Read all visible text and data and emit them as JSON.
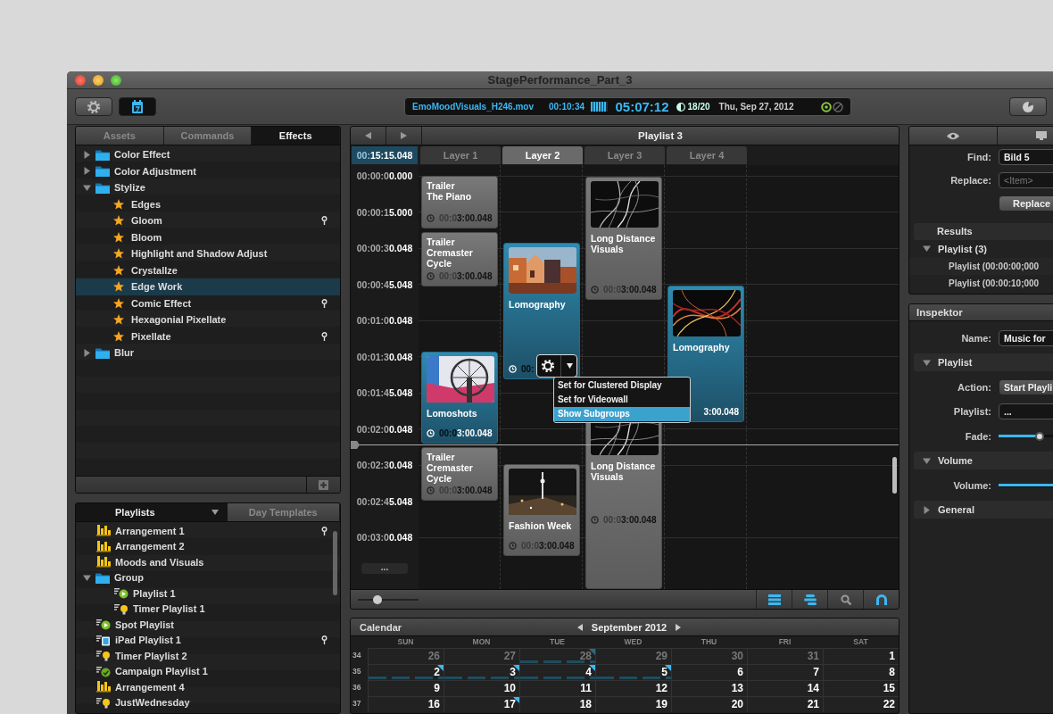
{
  "window": {
    "title": "StagePerformance_Part_3"
  },
  "toolbar": {
    "buttons": [
      {
        "kind": "settings",
        "selected": false
      },
      {
        "kind": "calendar",
        "selected": true
      },
      {
        "kind": "dial",
        "selected": false
      }
    ],
    "display": {
      "file": "EmoMoodVisuals_H246.mov",
      "elapsed": "00:10:34",
      "level": 0.85,
      "clock": "05:07:12",
      "count": "18/20",
      "date": "Thu, Sep 27, 2012"
    }
  },
  "effects_panel": {
    "tabs": [
      {
        "label": "Assets",
        "selected": false
      },
      {
        "label": "Commands",
        "selected": false
      },
      {
        "label": "Effects",
        "selected": true
      }
    ],
    "tree": [
      {
        "label": "Color Effect",
        "expanded": false,
        "selected": false,
        "pinned": false
      },
      {
        "label": "Color Adjustment",
        "expanded": false,
        "selected": false,
        "pinned": false
      },
      {
        "label": "Stylize",
        "expanded": true,
        "selected": false,
        "pinned": false,
        "children": [
          {
            "label": "Edges",
            "selected": false,
            "pinned": false
          },
          {
            "label": "Gloom",
            "selected": false,
            "pinned": true
          },
          {
            "label": "Bloom",
            "selected": false,
            "pinned": false
          },
          {
            "label": "Highlight and Shadow Adjust",
            "selected": false,
            "pinned": false
          },
          {
            "label": "Crystallze",
            "selected": false,
            "pinned": false
          },
          {
            "label": "Edge Work",
            "selected": true,
            "pinned": false
          },
          {
            "label": "Comic Effect",
            "selected": false,
            "pinned": true
          },
          {
            "label": "Hexagonial Pixellate",
            "selected": false,
            "pinned": false
          },
          {
            "label": "Pixellate",
            "selected": false,
            "pinned": true
          }
        ]
      },
      {
        "label": "Blur",
        "expanded": false,
        "selected": false,
        "pinned": false
      }
    ]
  },
  "playlists_panel": {
    "tabs": [
      {
        "label": "Playlists",
        "selected": true,
        "dropdown": true
      },
      {
        "label": "Day Templates",
        "selected": false,
        "dropdown": false
      }
    ],
    "items": [
      {
        "label": "Arrangement 1",
        "kind": "arrangement",
        "pinned": true
      },
      {
        "label": "Arrangement 2",
        "kind": "arrangement",
        "pinned": false
      },
      {
        "label": "Moods and Visuals",
        "kind": "arrangement",
        "pinned": false
      },
      {
        "label": "Group",
        "kind": "folder",
        "pinned": false,
        "expanded": true,
        "children": [
          {
            "label": "Playlist 1",
            "kind": "playlist",
            "pinned": false
          },
          {
            "label": "Timer Playlist 1",
            "kind": "timer",
            "pinned": false
          }
        ]
      },
      {
        "label": "Spot Playlist",
        "kind": "playlist",
        "pinned": false
      },
      {
        "label": "iPad Playlist 1",
        "kind": "tablet",
        "pinned": true
      },
      {
        "label": "Timer Playlist 2",
        "kind": "timer",
        "pinned": false
      },
      {
        "label": "Campaign Playlist 1",
        "kind": "campaign",
        "pinned": false
      },
      {
        "label": "Arrangement 4",
        "kind": "arrangement",
        "pinned": false
      },
      {
        "label": "JustWednesday",
        "kind": "timer",
        "pinned": false
      }
    ]
  },
  "timeline": {
    "title": "Playlist 3",
    "current_time": "00:**15:15.048**",
    "ruler": [
      "00:00:0**0.000**",
      "00:00:1**5.000**",
      "00:00:3**0.048**",
      "00:00:4**5.048**",
      "00:01:0**0.048**",
      "00:01:3**0.048**",
      "00:01:4**5.048**",
      "00:02:0**0.048**",
      "00:02:3**0.048**",
      "00:02:4**5.048**",
      "00:03:0**0.048**"
    ],
    "more_button": "...",
    "layers": [
      {
        "label": "Layer 1",
        "selected": false,
        "clips": [
          {
            "title_lines": [
              "Trailer",
              "The Piano"
            ],
            "duration": "00:0**3:00.048**",
            "selected": false,
            "thumbnail": false,
            "clock": true
          },
          {
            "title_lines": [
              "Trailer",
              "Cremaster",
              "Cycle"
            ],
            "duration": "00:0**3:00.048**",
            "selected": false,
            "thumbnail": false,
            "clock": true
          },
          {
            "title_lines": [
              "Lomoshots"
            ],
            "duration": "00:0**3:00.048**",
            "selected": true,
            "thumbnail": true,
            "clock": true
          },
          {
            "title_lines": [
              "Trailer",
              "Cremaster",
              "Cycle"
            ],
            "duration": "00:0**3:00.048**",
            "selected": false,
            "thumbnail": false,
            "clock": true
          }
        ]
      },
      {
        "label": "Layer 2",
        "selected": true,
        "clips": [
          {
            "title_lines": [
              "Lomography"
            ],
            "duration": "00:",
            "selected": true,
            "thumbnail": true,
            "clock": true
          },
          {
            "title_lines": [
              "Fashion Week"
            ],
            "duration": "00:0**3:00.048**",
            "selected": false,
            "thumbnail": true,
            "clock": true
          }
        ]
      },
      {
        "label": "Layer 3",
        "selected": false,
        "clips": [
          {
            "title_lines": [
              "Long Distance",
              "Visuals"
            ],
            "duration": "00:0**3:00.048**",
            "selected": false,
            "thumbnail": true,
            "clock": true
          },
          {
            "title_lines": [
              "Long Distance",
              "Visuals"
            ],
            "duration": "00:0**3:00.048**",
            "selected": false,
            "thumbnail": true,
            "clock": true
          }
        ]
      },
      {
        "label": "Layer 4",
        "selected": false,
        "clips": [
          {
            "title_lines": [
              "Lomography"
            ],
            "duration": "**3:00.048**",
            "selected": true,
            "thumbnail": true,
            "clock": false
          }
        ]
      }
    ],
    "gear_menu": {
      "items": [
        {
          "label": "Set for Clustered Display",
          "selected": false
        },
        {
          "label": "Set for Videowall",
          "selected": false
        },
        {
          "label": "Show Subgroups",
          "selected": true
        }
      ]
    },
    "zoom": {
      "level": 0.33
    },
    "tools": [
      {
        "kind": "list",
        "on": true
      },
      {
        "kind": "align",
        "on": true
      },
      {
        "kind": "search",
        "on": false
      },
      {
        "kind": "magnet",
        "on": true
      }
    ]
  },
  "calendar": {
    "title": "Calendar",
    "month": "September 2012",
    "weekdays": [
      "SUN",
      "MON",
      "TUE",
      "WED",
      "THU",
      "FRI",
      "SAT"
    ],
    "weeks": [
      {
        "number": "34",
        "days": [
          {
            "day": "26",
            "muted": true,
            "marked": false,
            "events": false
          },
          {
            "day": "27",
            "muted": true,
            "marked": false,
            "events": false
          },
          {
            "day": "28",
            "muted": true,
            "marked": true,
            "events": true
          },
          {
            "day": "29",
            "muted": true,
            "marked": false,
            "events": false
          },
          {
            "day": "30",
            "muted": true,
            "marked": false,
            "events": false
          },
          {
            "day": "31",
            "muted": true,
            "marked": false,
            "events": false
          },
          {
            "day": "1",
            "muted": false,
            "marked": false,
            "events": false
          }
        ]
      },
      {
        "number": "35",
        "days": [
          {
            "day": "2",
            "muted": false,
            "marked": true,
            "events": true
          },
          {
            "day": "3",
            "muted": false,
            "marked": true,
            "events": true
          },
          {
            "day": "4",
            "muted": false,
            "marked": true,
            "events": true
          },
          {
            "day": "5",
            "muted": false,
            "marked": true,
            "events": true
          },
          {
            "day": "6",
            "muted": false,
            "marked": false,
            "events": false
          },
          {
            "day": "7",
            "muted": false,
            "marked": false,
            "events": false
          },
          {
            "day": "8",
            "muted": false,
            "marked": false,
            "events": false
          }
        ]
      },
      {
        "number": "36",
        "days": [
          {
            "day": "9",
            "muted": false,
            "marked": false,
            "events": false
          },
          {
            "day": "10",
            "muted": false,
            "marked": false,
            "events": false
          },
          {
            "day": "11",
            "muted": false,
            "marked": false,
            "events": false
          },
          {
            "day": "12",
            "muted": false,
            "marked": false,
            "events": false
          },
          {
            "day": "13",
            "muted": false,
            "marked": false,
            "events": false
          },
          {
            "day": "14",
            "muted": false,
            "marked": false,
            "events": false
          },
          {
            "day": "15",
            "muted": false,
            "marked": false,
            "events": false
          }
        ]
      },
      {
        "number": "37",
        "days": [
          {
            "day": "16",
            "muted": false,
            "marked": false,
            "events": false
          },
          {
            "day": "17",
            "muted": false,
            "marked": true,
            "events": false
          },
          {
            "day": "18",
            "muted": false,
            "marked": false,
            "events": false
          },
          {
            "day": "19",
            "muted": false,
            "marked": false,
            "events": false
          },
          {
            "day": "20",
            "muted": false,
            "marked": false,
            "events": false
          },
          {
            "day": "21",
            "muted": false,
            "marked": false,
            "events": false
          },
          {
            "day": "22",
            "muted": false,
            "marked": false,
            "events": false
          }
        ]
      }
    ]
  },
  "find_panel": {
    "tabs": [
      {
        "kind": "eye"
      },
      {
        "kind": "monitor"
      }
    ],
    "find": {
      "label": "Find:",
      "value": "Bild 5"
    },
    "replace": {
      "label": "Replace:",
      "placeholder": "<Item>"
    },
    "replace_button": "Replace",
    "results": {
      "title": "Results",
      "groups": [
        {
          "label": "Playlist (3)",
          "expanded": true,
          "children": [
            {
              "label": "Playlist (00:00:00;000"
            },
            {
              "label": "Playlist (00:00:10;000"
            }
          ]
        }
      ]
    }
  },
  "inspector": {
    "title": "Inspektor",
    "name": {
      "label": "Name:",
      "value": "Music for"
    },
    "sections": [
      {
        "title": "Playlist",
        "expanded": true,
        "rows": [
          {
            "kind": "dropdown",
            "label": "Action:",
            "value": "Start Playli"
          },
          {
            "kind": "field",
            "label": "Playlist:",
            "value": "..."
          },
          {
            "kind": "slider",
            "label": "Fade:",
            "level": 0.42
          }
        ]
      },
      {
        "title": "Volume",
        "expanded": true,
        "rows": [
          {
            "kind": "slider",
            "label": "Volume:",
            "level": 0.95
          }
        ]
      },
      {
        "title": "General",
        "expanded": false
      }
    ]
  }
}
